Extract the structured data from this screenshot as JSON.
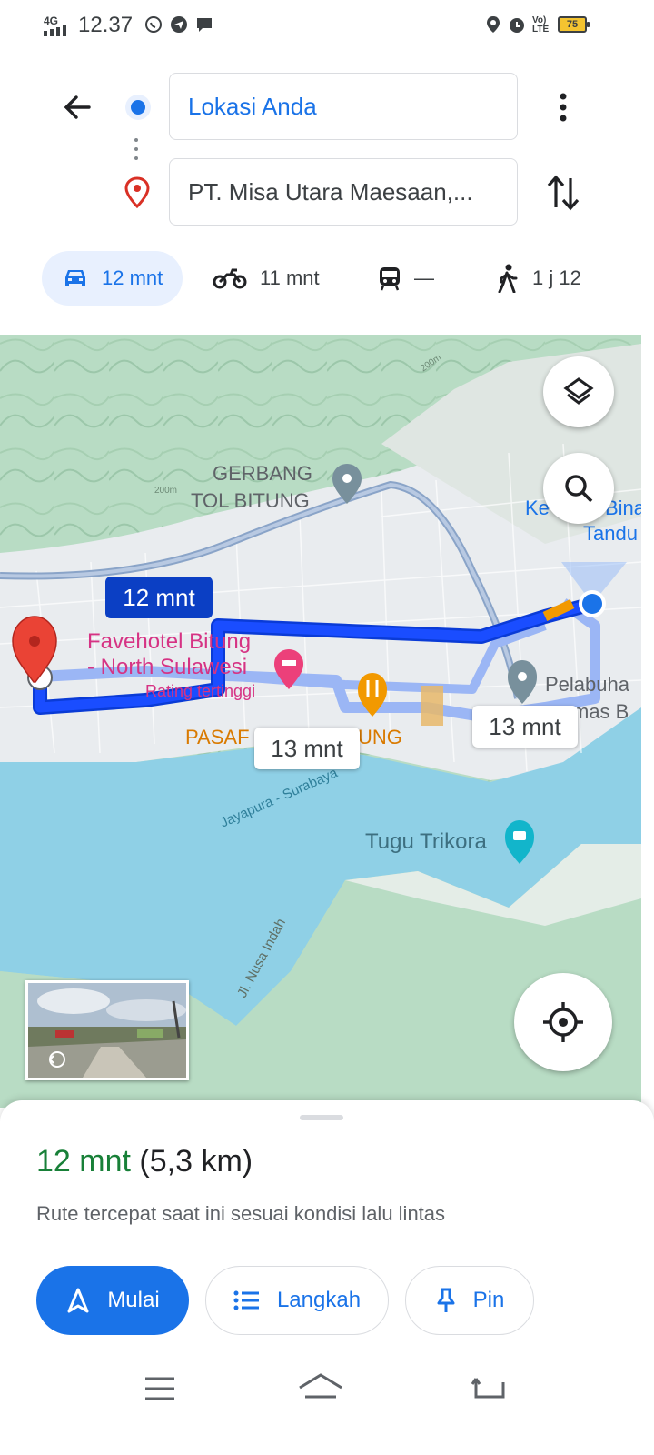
{
  "status_bar": {
    "network": "4G",
    "time": "12.37",
    "battery": "75",
    "volte": "Vo) LTE"
  },
  "route": {
    "origin": "Lokasi Anda",
    "destination": "PT. Misa Utara Maesaan,..."
  },
  "modes": [
    {
      "icon": "car-icon",
      "label": "12 mnt",
      "active": true
    },
    {
      "icon": "motorcycle-icon",
      "label": "11 mnt"
    },
    {
      "icon": "transit-icon",
      "label": "—"
    },
    {
      "icon": "walk-icon",
      "label": "1 j 12"
    }
  ],
  "map": {
    "labels": {
      "toll_gate": "GERBANG",
      "toll_gate2": "TOL BITUNG",
      "hotel1": "Favehotel Bitung",
      "hotel2": "- North Sulawesi",
      "hotel_rating": "Rating tertinggi",
      "market": "PASAR BITUNG",
      "market_left": "PASAF",
      "market_right": "UNG",
      "harbor1": "Pelabuha",
      "harbor2": "mas B",
      "top_right1": "Ke",
      "top_right2": "Bina",
      "top_right3": "Tandu",
      "monument": "Tugu Trikora",
      "road1": "Jayapura - Surabaya",
      "road2": "Jl. Nusa Indah",
      "contour1": "200m",
      "contour2": "200m"
    },
    "callouts": {
      "main": "12 mnt",
      "alt1": "13 mnt",
      "alt2": "13 mnt"
    },
    "colors": {
      "route": "#1a4dff",
      "alt_route": "#9bb6f5",
      "water": "#8fd0e6",
      "land": "#b8dcc4"
    }
  },
  "summary": {
    "duration": "12 mnt",
    "distance": "(5,3 km)",
    "description": "Rute tercepat saat ini sesuai kondisi lalu lintas"
  },
  "actions": {
    "start": "Mulai",
    "steps": "Langkah",
    "pin": "Pin"
  }
}
